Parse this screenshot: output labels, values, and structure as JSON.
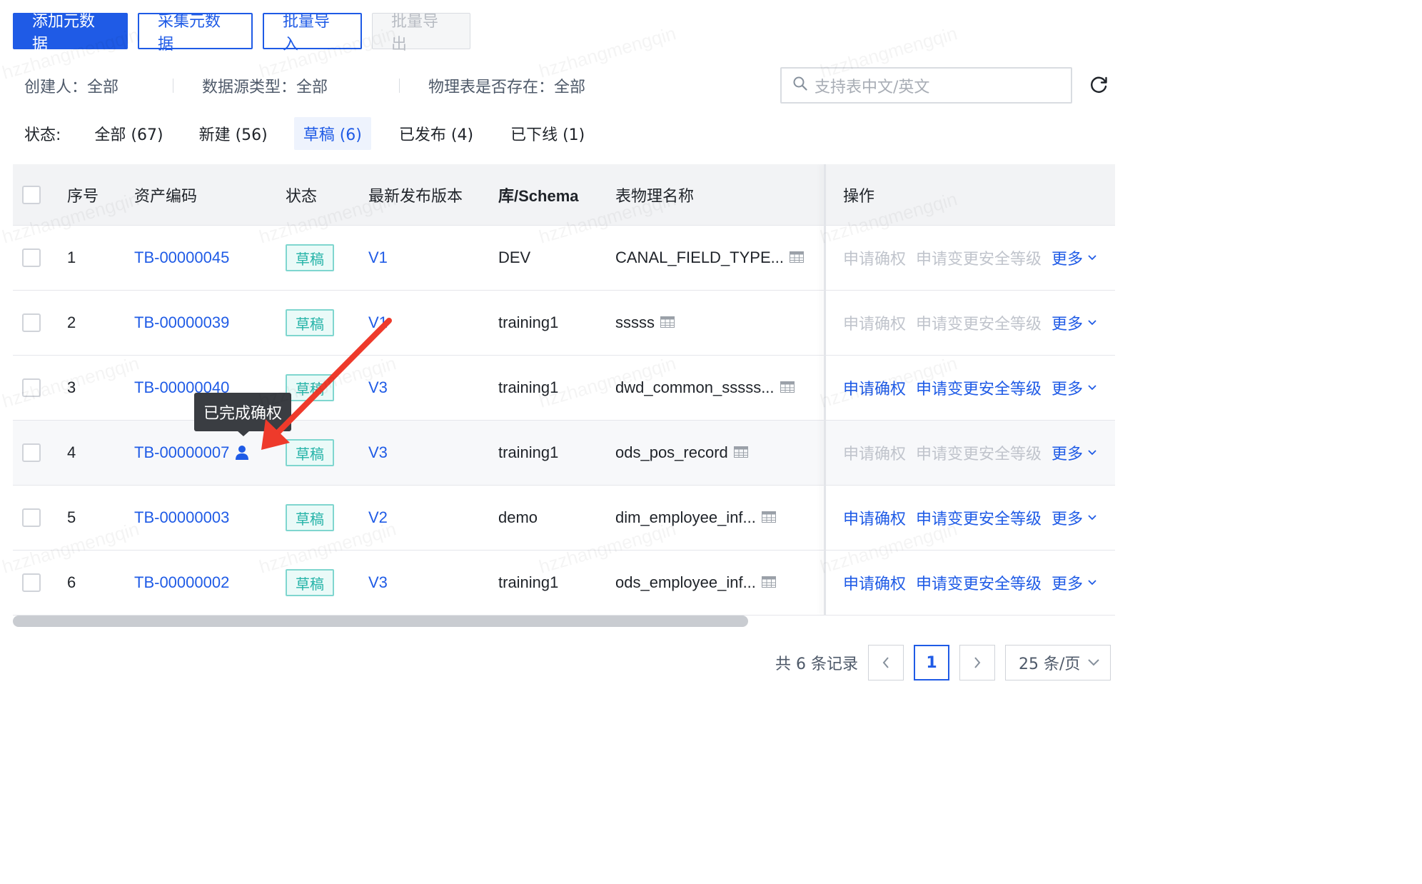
{
  "toolbar": {
    "add_label": "添加元数据",
    "collect_label": "采集元数据",
    "import_label": "批量导入",
    "export_label": "批量导出"
  },
  "filters": {
    "creator": "创建人：全部",
    "datasource": "数据源类型：全部",
    "physical_exists": "物理表是否存在：全部",
    "search_placeholder": "支持表中文/英文"
  },
  "status": {
    "label": "状态:",
    "tabs": [
      {
        "label": "全部 (67)",
        "active": false
      },
      {
        "label": "新建 (56)",
        "active": false
      },
      {
        "label": "草稿 (6)",
        "active": true
      },
      {
        "label": "已发布 (4)",
        "active": false
      },
      {
        "label": "已下线 (1)",
        "active": false
      }
    ]
  },
  "table": {
    "headers": {
      "index": "序号",
      "code": "资产编码",
      "status": "状态",
      "version": "最新发布版本",
      "schema": "库/Schema",
      "table_name": "表物理名称",
      "ops": "操作"
    },
    "rows": [
      {
        "index": "1",
        "code": "TB-00000045",
        "status": "草稿",
        "version": "V1",
        "schema": "DEV",
        "table_name": "CANAL_FIELD_TYPE...",
        "ops_enabled": false,
        "hovered": false,
        "confirmed": false
      },
      {
        "index": "2",
        "code": "TB-00000039",
        "status": "草稿",
        "version": "V1",
        "schema": "training1",
        "table_name": "sssss",
        "ops_enabled": false,
        "hovered": false,
        "confirmed": false
      },
      {
        "index": "3",
        "code": "TB-00000040",
        "status": "草稿",
        "version": "V3",
        "schema": "training1",
        "table_name": "dwd_common_sssss...",
        "ops_enabled": true,
        "hovered": false,
        "confirmed": false
      },
      {
        "index": "4",
        "code": "TB-00000007",
        "status": "草稿",
        "version": "V3",
        "schema": "training1",
        "table_name": "ods_pos_record",
        "ops_enabled": false,
        "hovered": true,
        "confirmed": true
      },
      {
        "index": "5",
        "code": "TB-00000003",
        "status": "草稿",
        "version": "V2",
        "schema": "demo",
        "table_name": "dim_employee_inf...",
        "ops_enabled": true,
        "hovered": false,
        "confirmed": false
      },
      {
        "index": "6",
        "code": "TB-00000002",
        "status": "草稿",
        "version": "V3",
        "schema": "training1",
        "table_name": "ods_employee_inf...",
        "ops_enabled": true,
        "hovered": false,
        "confirmed": false
      }
    ],
    "op_labels": {
      "apply_confirm": "申请确权",
      "apply_change_level": "申请变更安全等级",
      "more": "更多"
    }
  },
  "tooltip": {
    "text": "已完成确权"
  },
  "pagination": {
    "total": "共 6 条记录",
    "current_page": "1",
    "page_size": "25 条/页"
  },
  "watermark": "hzzhangmengqin",
  "colors": {
    "primary": "#1f5be6",
    "tag_text": "#25b3a8",
    "tag_border": "#7fd6cf",
    "annotation": "#ee3a2b"
  }
}
